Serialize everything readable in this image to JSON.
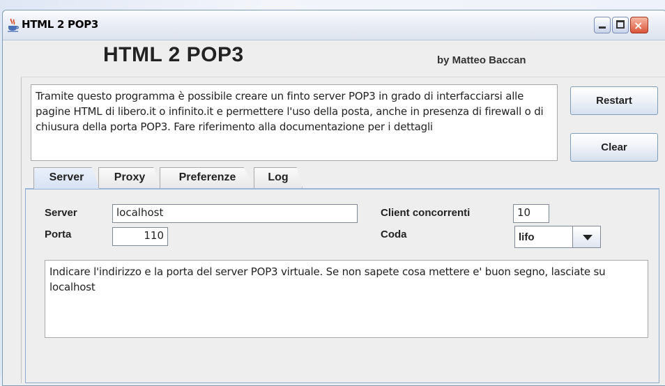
{
  "window": {
    "title": "HTML 2 POP3",
    "icon": "java-coffee-cup-icon",
    "controls": {
      "minimize": "minimize-icon",
      "maximize": "maximize-icon",
      "close": "×"
    }
  },
  "header": {
    "title": "HTML 2 POP3",
    "author": "by Matteo Baccan"
  },
  "description": "Tramite questo programma è possibile creare un finto server POP3 in grado di interfacciarsi alle pagine HTML di libero.it o infinito.it e permettere l'uso della posta, anche in presenza di firewall o di chiusura della porta POP3. Fare riferimento alla documentazione per i dettagli",
  "buttons": {
    "restart": "Restart",
    "clear": "Clear"
  },
  "tabs": [
    {
      "label": "Server",
      "active": true
    },
    {
      "label": "Proxy",
      "active": false
    },
    {
      "label": "Preferenze",
      "active": false
    },
    {
      "label": "Log",
      "active": false
    }
  ],
  "server_tab": {
    "server_label": "Server",
    "server_value": "localhost",
    "porta_label": "Porta",
    "porta_value": "110",
    "client_label": "Client concorrenti",
    "client_value": "10",
    "coda_label": "Coda",
    "coda_value": "lifo",
    "help_text": "Indicare l'indirizzo e la porta del server POP3 virtuale. Se non sapete cosa mettere e' buon segno, lasciate su localhost"
  },
  "colors": {
    "window_bg": "#eeeeee",
    "tab_panel_border": "#8da9cc",
    "close_button": "#d9553a"
  }
}
